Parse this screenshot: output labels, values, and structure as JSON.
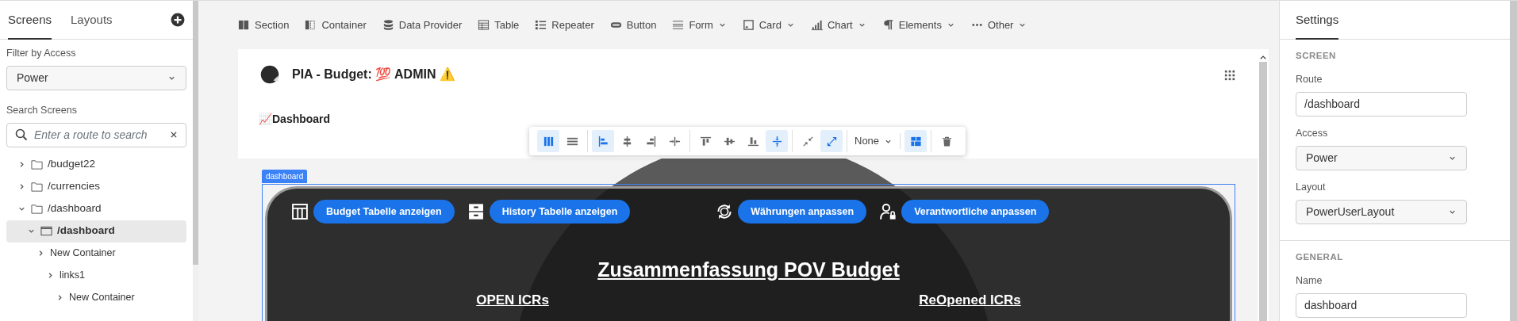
{
  "left_panel": {
    "tabs": [
      {
        "label": "Screens",
        "selected": true
      },
      {
        "label": "Layouts",
        "selected": false
      }
    ],
    "filter": {
      "label": "Filter by Access",
      "value": "Power"
    },
    "search": {
      "label": "Search Screens",
      "placeholder": "Enter a route to search"
    },
    "tree": [
      {
        "label": "/budget22",
        "expanded": false,
        "selected": false
      },
      {
        "label": "/currencies",
        "expanded": false,
        "selected": false
      },
      {
        "label": "/dashboard",
        "expanded": true,
        "selected": false,
        "children": [
          {
            "label": "/dashboard",
            "expanded": true,
            "selected": true,
            "children": [
              {
                "label": "New Container",
                "expanded": false,
                "selected": false,
                "children": [
                  {
                    "label": "links1",
                    "expanded": false,
                    "selected": false,
                    "children": [
                      {
                        "label": "New Container",
                        "expanded": false,
                        "selected": false
                      }
                    ]
                  }
                ]
              }
            ]
          }
        ]
      }
    ]
  },
  "toolbar": [
    {
      "label": "Section",
      "menu": false
    },
    {
      "label": "Container",
      "menu": false
    },
    {
      "label": "Data Provider",
      "menu": false
    },
    {
      "label": "Table",
      "menu": false
    },
    {
      "label": "Repeater",
      "menu": false
    },
    {
      "label": "Button",
      "menu": false
    },
    {
      "label": "Form",
      "menu": true
    },
    {
      "label": "Card",
      "menu": true
    },
    {
      "label": "Chart",
      "menu": true
    },
    {
      "label": "Elements",
      "menu": true
    },
    {
      "label": "Other",
      "menu": true
    }
  ],
  "screen": {
    "title": "PIA - Budget: 💯 ADMIN ⚠️",
    "page_label": "📈Dashboard",
    "layout_toolbar": [
      [
        {
          "kind": "button",
          "active": true
        },
        {
          "kind": "button",
          "active": false
        }
      ],
      [
        {
          "kind": "button",
          "active": true
        },
        {
          "kind": "button",
          "active": false
        },
        {
          "kind": "button",
          "active": false
        },
        {
          "kind": "button",
          "active": false
        }
      ],
      [
        {
          "kind": "button",
          "active": false
        },
        {
          "kind": "button",
          "active": false
        },
        {
          "kind": "button",
          "active": false
        },
        {
          "kind": "button",
          "active": true
        }
      ],
      [
        {
          "kind": "button",
          "active": false
        },
        {
          "kind": "button",
          "active": true
        }
      ],
      [
        {
          "kind": "dropdown",
          "label": "None"
        }
      ],
      [
        {
          "kind": "button",
          "active": true
        }
      ],
      [
        {
          "kind": "button",
          "active": false
        }
      ]
    ],
    "selection_tag": "dashboard",
    "actions": [
      "Budget Tabelle anzeigen",
      "History Tabelle anzeigen",
      "Währungen anpassen",
      "Verantwortliche anpassen"
    ],
    "heading": "Zusammenfassung POV Budget",
    "subheadings": [
      "OPEN ICRs",
      "ReOpened ICRs"
    ]
  },
  "settings": {
    "tab": "Settings",
    "sections": [
      {
        "title": "SCREEN",
        "fields": [
          {
            "label": "Route",
            "kind": "input",
            "value": "/dashboard"
          },
          {
            "label": "Access",
            "kind": "select",
            "value": "Power"
          },
          {
            "label": "Layout",
            "kind": "select",
            "value": "PowerUserLayout"
          }
        ]
      },
      {
        "title": "GENERAL",
        "fields": [
          {
            "label": "Name",
            "kind": "input",
            "value": "dashboard"
          }
        ]
      }
    ]
  }
}
